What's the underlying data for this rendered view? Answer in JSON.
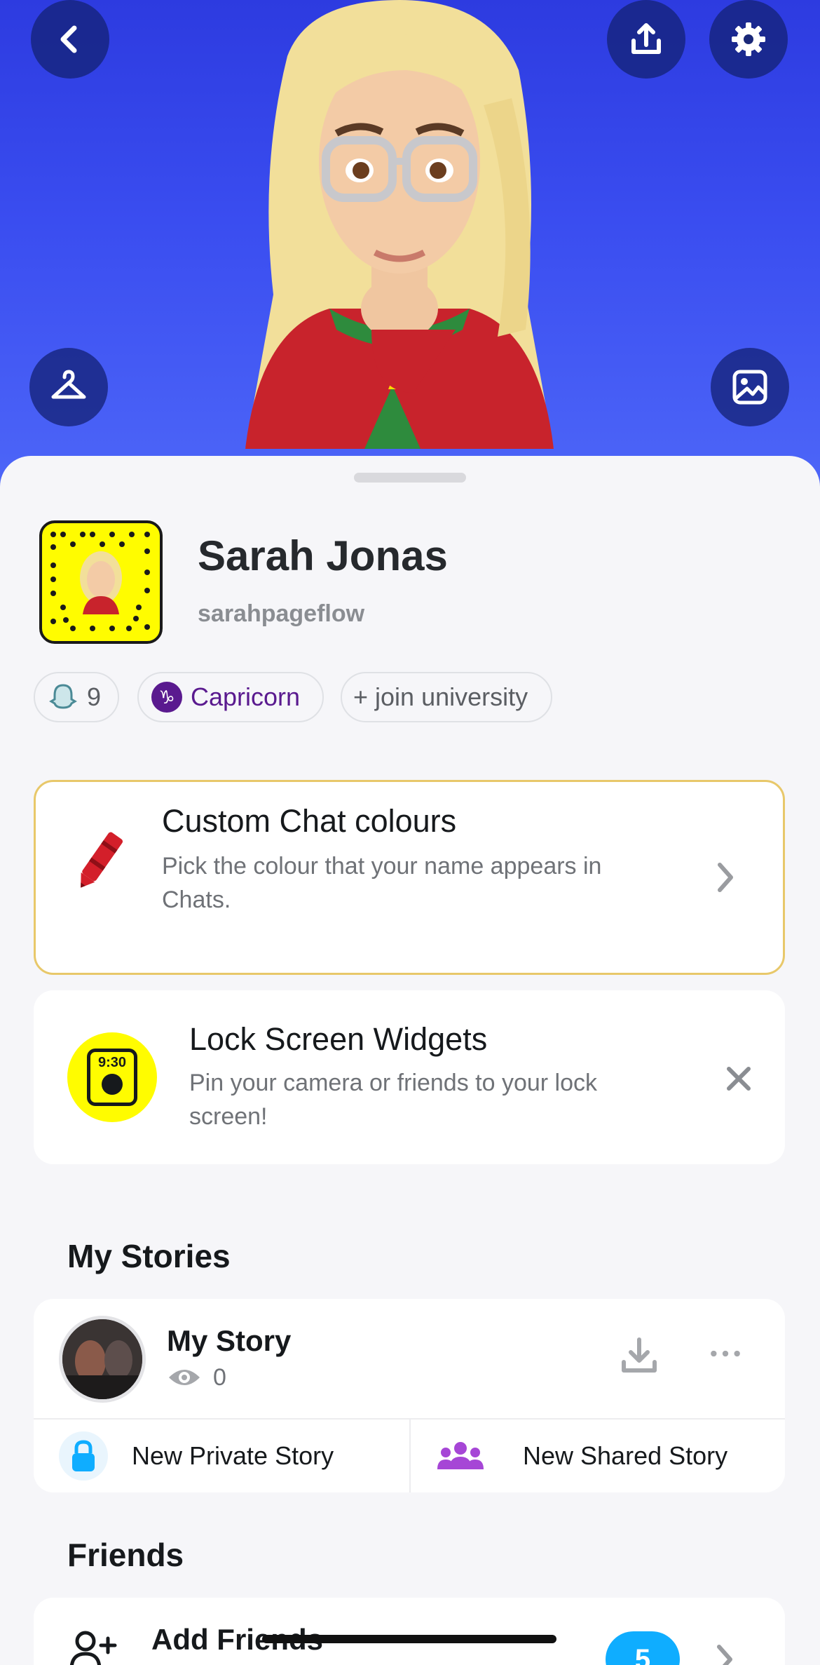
{
  "profile": {
    "display_name": "Sarah Jonas",
    "username": "sarahpageflow",
    "snapscore": "9",
    "zodiac": "Capricorn",
    "zodiac_glyph": "♑",
    "university_action": "+ join university"
  },
  "chat_colours_card": {
    "title": "Custom Chat colours",
    "subtitle": "Pick the colour that your name appears in Chats."
  },
  "widgets_card": {
    "title": "Lock Screen Widgets",
    "subtitle": "Pin your camera or friends to your lock screen!",
    "icon_time": "9:30"
  },
  "stories": {
    "section_title": "My Stories",
    "my_story_title": "My Story",
    "my_story_views": "0",
    "new_private_label": "New Private Story",
    "new_shared_label": "New Shared Story"
  },
  "friends": {
    "section_title": "Friends",
    "add_friends_label": "Add Friends",
    "add_friends_count": "5"
  },
  "colors": {
    "hero_bg": "#3a4df0",
    "snap_yellow": "#fffc00",
    "chat_card_border": "#e8c86a",
    "accent_blue": "#0fadff",
    "zodiac_purple": "#5a1a8f"
  },
  "icons": [
    "back-icon",
    "share-icon",
    "settings-icon",
    "hanger-icon",
    "image-icon",
    "crayon-icon",
    "chevron-right-icon",
    "close-icon",
    "download-icon",
    "more-icon",
    "lock-icon",
    "group-icon",
    "eye-icon",
    "add-friend-icon"
  ]
}
